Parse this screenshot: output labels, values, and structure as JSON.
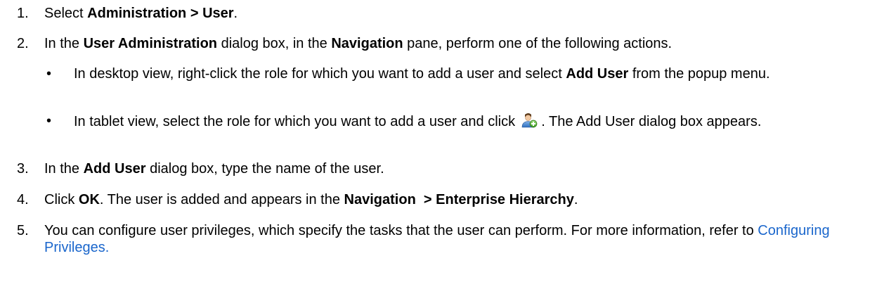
{
  "steps": {
    "s1": {
      "number": "1.",
      "text_a": "Select ",
      "bold_a": "Administration > User",
      "text_b": "."
    },
    "s2": {
      "number": "2.",
      "text_a": "In the ",
      "bold_a": "User Administration",
      "text_b": " dialog box, in the ",
      "bold_b": "Navigation",
      "text_c": " pane, perform one of the following actions."
    },
    "b1": {
      "bullet": "•",
      "text_a": "In desktop view, right-click the role for which you want to add a user and select ",
      "bold_a": "Add User",
      "text_b": " from the popup menu."
    },
    "b2": {
      "bullet": "•",
      "text_a": "In tablet view, select the role for which you want to add a user and click ",
      "text_b": " . The Add User dialog box appears.",
      "icon": "add-user-icon"
    },
    "s3": {
      "number": "3.",
      "text_a": "In the ",
      "bold_a": "Add User",
      "text_b": " dialog box, type the name of the user."
    },
    "s4": {
      "number": "4.",
      "text_a": "Click ",
      "bold_a": "OK",
      "text_b": ". The user is added and appears in the ",
      "bold_b": "Navigation  > Enterprise Hierarchy",
      "text_c": "."
    },
    "s5": {
      "number": "5.",
      "text_a": "You can configure user privileges, which specify the tasks that the user can perform. For more information, refer to ",
      "link": "Configuring Privileges."
    }
  },
  "colors": {
    "link": "#1a66cc",
    "text": "#000000"
  }
}
